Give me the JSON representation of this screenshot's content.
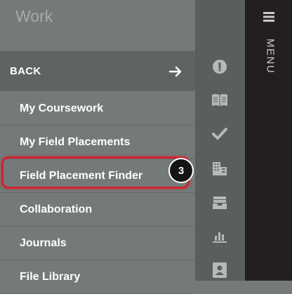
{
  "panel": {
    "title": "Work",
    "back_label": "BACK",
    "items": [
      {
        "label": "My Coursework"
      },
      {
        "label": "My Field Placements"
      },
      {
        "label": "Field Placement Finder"
      },
      {
        "label": "Collaboration"
      },
      {
        "label": "Journals"
      },
      {
        "label": "File Library"
      }
    ]
  },
  "annotation": {
    "step": "3",
    "highlight_color": "#d3202f"
  },
  "rail": {
    "icons": [
      "dashboard-icon",
      "book-icon",
      "check-icon",
      "building-icon",
      "inbox-icon",
      "chart-icon",
      "profile-icon"
    ]
  },
  "menu": {
    "label": "MENU"
  },
  "colors": {
    "panel_bg": "#737a79",
    "back_bg": "#5e6463",
    "rail_bg": "#5a5f5e",
    "menu_bg": "#231f20",
    "icon_color": "#b5b9b8"
  }
}
